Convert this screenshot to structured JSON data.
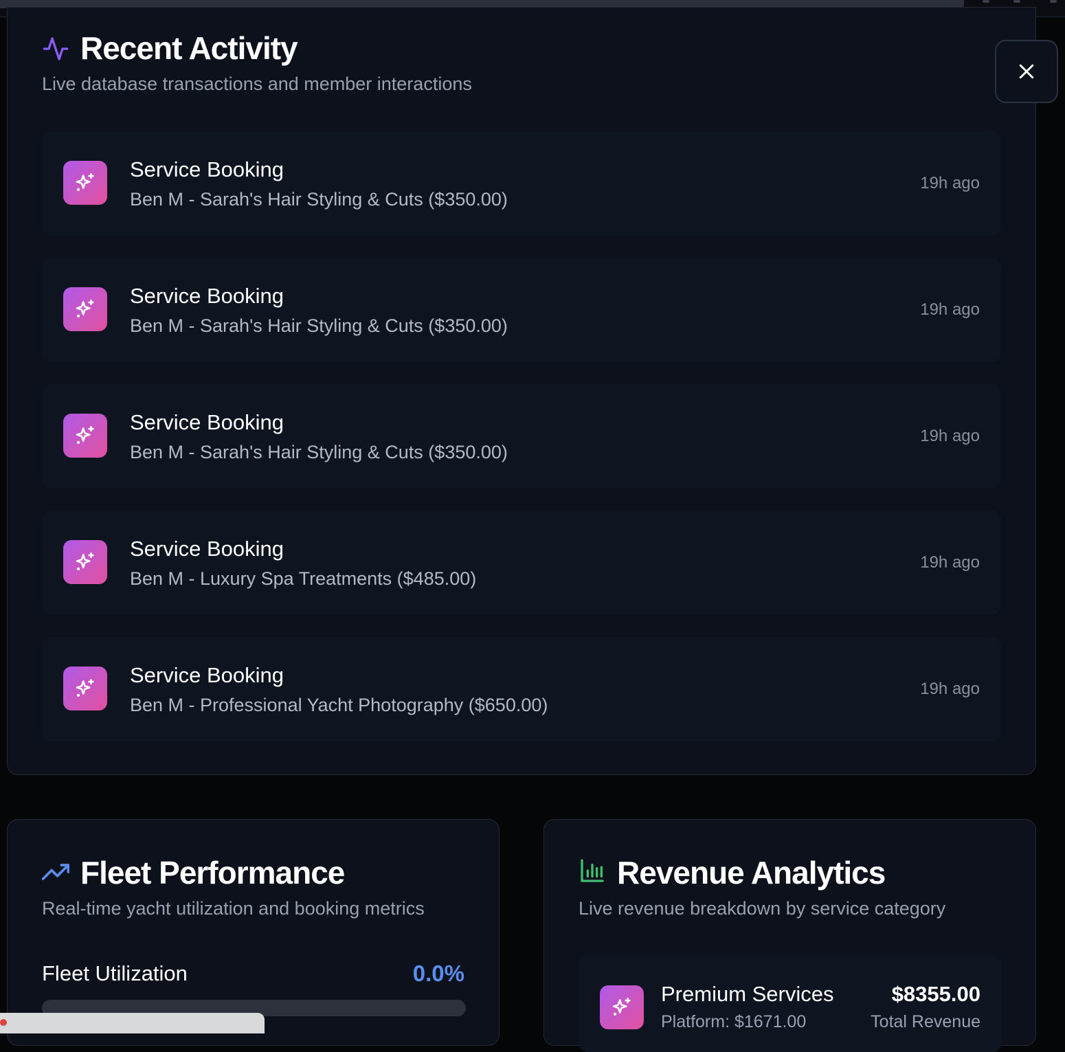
{
  "activity": {
    "title": "Recent Activity",
    "subtitle": "Live database transactions and member interactions",
    "icon": "activity-icon",
    "close_icon": "close-icon",
    "items": [
      {
        "title": "Service Booking",
        "desc": "Ben M - Sarah's Hair Styling & Cuts ($350.00)",
        "time": "19h ago",
        "icon": "sparkles-icon"
      },
      {
        "title": "Service Booking",
        "desc": "Ben M - Sarah's Hair Styling & Cuts ($350.00)",
        "time": "19h ago",
        "icon": "sparkles-icon"
      },
      {
        "title": "Service Booking",
        "desc": "Ben M - Sarah's Hair Styling & Cuts ($350.00)",
        "time": "19h ago",
        "icon": "sparkles-icon"
      },
      {
        "title": "Service Booking",
        "desc": "Ben M - Luxury Spa Treatments ($485.00)",
        "time": "19h ago",
        "icon": "sparkles-icon"
      },
      {
        "title": "Service Booking",
        "desc": "Ben M - Professional Yacht Photography ($650.00)",
        "time": "19h ago",
        "icon": "sparkles-icon"
      }
    ]
  },
  "fleet": {
    "title": "Fleet Performance",
    "subtitle": "Real-time yacht utilization and booking metrics",
    "icon": "trending-up-icon",
    "utilization_label": "Fleet Utilization",
    "utilization_value": "0.0%",
    "utilization_fraction": 0.0
  },
  "revenue": {
    "title": "Revenue Analytics",
    "subtitle": "Live revenue breakdown by service category",
    "icon": "bar-chart-icon",
    "items": [
      {
        "name": "Premium Services",
        "amount": "$8355.00",
        "platform": "Platform: $1671.00",
        "total_label": "Total Revenue",
        "icon": "sparkles-icon"
      }
    ]
  },
  "colors": {
    "accent_purple": "#8b5cf6",
    "accent_blue": "#5b8def",
    "accent_green": "#3fbf6f",
    "badge_gradient_start": "#b15ae8",
    "badge_gradient_end": "#e0519e"
  }
}
